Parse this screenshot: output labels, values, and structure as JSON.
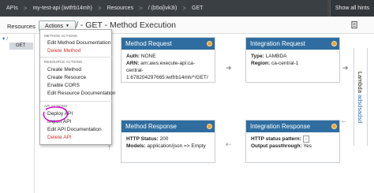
{
  "topbar": {
    "crumbs": [
      "APIs",
      "my-test-api (iwtfrb14mh)",
      "Resources",
      "/ (b5o{ivk3i)",
      "GET"
    ],
    "hints_label": "Show all hints"
  },
  "subbar": {
    "resources_label": "Resources",
    "actions_label": "Actions",
    "title": "/ - GET - Method Execution"
  },
  "tree": {
    "root": "/",
    "method": "GET"
  },
  "menu": {
    "method_actions_header": "METHOD ACTIONS",
    "method_items": [
      "Edit Method Documentation",
      "Delete Method"
    ],
    "resource_actions_header": "RESOURCE ACTIONS",
    "resource_items": [
      "Create Method",
      "Create Resource",
      "Enable CORS",
      "Edit Resource Documentation"
    ],
    "api_actions_header": "API ACTIONS",
    "api_items": [
      "Deploy API",
      "Import API",
      "Edit API Documentation",
      "Delete API"
    ]
  },
  "boxes": {
    "method_request": {
      "title": "Method Request",
      "auth_key": "Auth:",
      "auth_val": "NONE",
      "arn_key": "ARN:",
      "arn_val": "arn:aws:execute-api:ca-central-1:678204297665:iwtfrb14mh/*/GET/"
    },
    "integration_request": {
      "title": "Integration Request",
      "type_key": "Type:",
      "type_val": "LAMBDA",
      "region_key": "Region:",
      "region_val": "ca-central-1"
    },
    "method_response": {
      "title": "Method Response",
      "status_key": "HTTP Status:",
      "status_val": "200",
      "models_key": "Models:",
      "models_val": "application/json => Empty"
    },
    "integration_response": {
      "title": "Integration Response",
      "pattern_key": "HTTP status pattern:",
      "pattern_val": "-",
      "passthrough_key": "Output passthrough:",
      "passthrough_val": "Yes"
    }
  },
  "lambda": {
    "label": "Lambda",
    "function": "adsdsadsd"
  },
  "colors": {
    "topbar": "#3a3f44",
    "box_header": "#2f6da0",
    "danger": "#d0342c",
    "link": "#1f6fb4",
    "highlight": "#c800c8"
  }
}
